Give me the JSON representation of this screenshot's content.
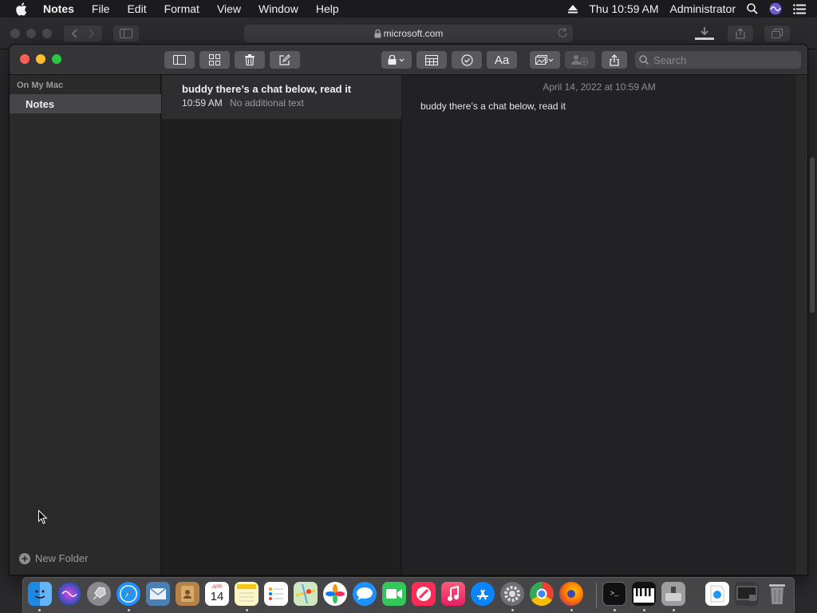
{
  "menubar": {
    "app_name": "Notes",
    "items": [
      "File",
      "Edit",
      "Format",
      "View",
      "Window",
      "Help"
    ],
    "clock": "Thu 10:59 AM",
    "user": "Administrator"
  },
  "safari": {
    "url": "microsoft.com"
  },
  "notes": {
    "sidebar": {
      "section_label": "On My Mac",
      "folder_label": "Notes",
      "new_folder_label": "New Folder"
    },
    "search_placeholder": "Search",
    "list": [
      {
        "title": "buddy there’s a chat below, read it",
        "time": "10:59 AM",
        "preview": "No additional text"
      }
    ],
    "editor": {
      "date": "April 14, 2022 at 10:59 AM",
      "body": "buddy there’s a chat below, read it"
    }
  },
  "calendar_icon": {
    "month": "APR",
    "day": "14"
  },
  "colors": {
    "close": "#ff5f57",
    "minimize": "#febc2e",
    "zoom": "#28c840"
  },
  "dock": [
    "finder-icon",
    "siri-icon",
    "launchpad-icon",
    "safari-icon",
    "mail-icon",
    "contacts-icon",
    "calendar-icon",
    "notes-icon",
    "reminders-icon",
    "maps-icon",
    "photos-icon",
    "messages-icon",
    "facetime-icon",
    "news-icon",
    "music-icon",
    "app-store-icon",
    "system-preferences-icon",
    "chrome-icon",
    "firefox-icon",
    "terminal-icon",
    "piano-icon",
    "disk-utility-icon",
    "preview-icon",
    "screenshot-icon",
    "trash-icon"
  ]
}
